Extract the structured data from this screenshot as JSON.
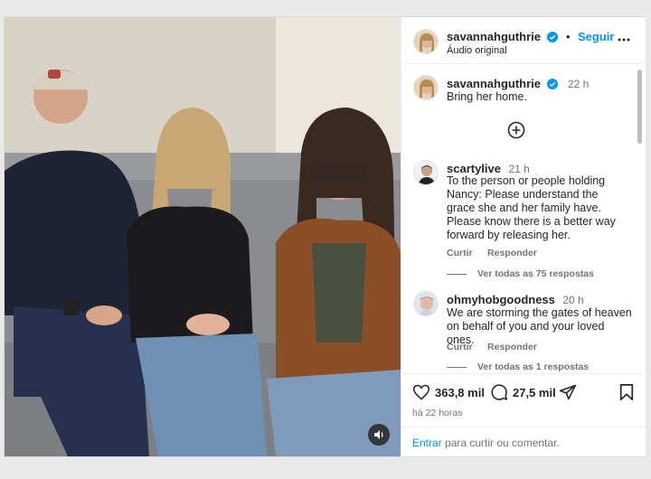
{
  "post": {
    "username": "savannahguthrie",
    "follow_label": "Seguir",
    "audio_label": "Áudio original",
    "more_icon": "more-horizontal-icon"
  },
  "caption": {
    "username": "savannahguthrie",
    "time": "22 h",
    "text": "Bring her home."
  },
  "comments": [
    {
      "username": "scartylive",
      "time": "21 h",
      "text": "To the person or people holding Nancy: Please understand the grace she and her family have. Please know there is a better way forward by releasing her.",
      "like_label": "Curtir",
      "reply_label": "Responder",
      "view_replies": "Ver todas as 75 respostas"
    },
    {
      "username": "ohmyhobgoodness",
      "time": "20 h",
      "text": "We are storming the gates of heaven on behalf of you and your loved ones.",
      "like_label": "Curtir",
      "reply_label": "Responder",
      "view_replies": "Ver todas as 1 respostas"
    }
  ],
  "footer": {
    "likes": "363,8 mil",
    "comments": "27,5 mil",
    "time_ago": "há 22 horas",
    "login_link": "Entrar",
    "login_text": " para curtir ou comentar."
  },
  "colors": {
    "accent": "#0095f6",
    "verified": "#0095f6",
    "text": "#262626",
    "muted": "#737373"
  }
}
